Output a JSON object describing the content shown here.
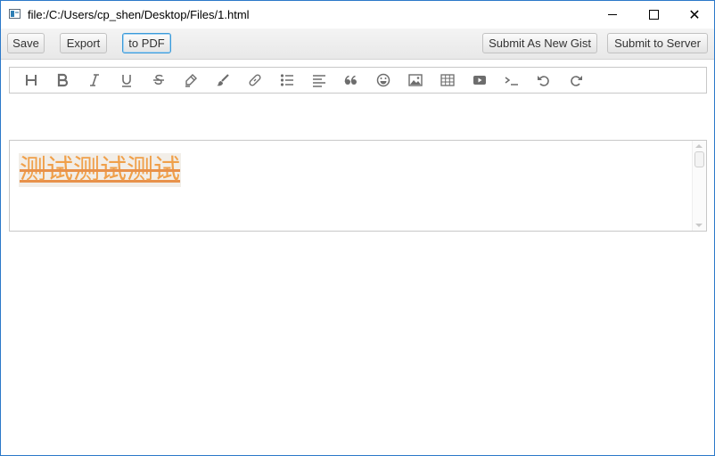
{
  "window": {
    "title": "file:/C:/Users/cp_shen/Desktop/Files/1.html",
    "controls": [
      "minimize-icon",
      "maximize-icon",
      "close-icon"
    ],
    "close_glyph": "✕"
  },
  "toolbar": {
    "save_label": "Save",
    "export_label": "Export",
    "pdf_label": "to PDF",
    "gist_label": "Submit As New Gist",
    "server_label": "Submit to Server"
  },
  "editor_toolbar": {
    "tools": [
      "heading-icon",
      "bold-icon",
      "italic-icon",
      "underline-icon",
      "strikethrough-icon",
      "highlighter-icon",
      "brush-icon",
      "link-icon",
      "bullet-list-icon",
      "align-left-icon",
      "quote-icon",
      "emoji-icon",
      "image-icon",
      "table-icon",
      "video-icon",
      "code-icon",
      "undo-icon",
      "redo-icon"
    ],
    "icon_color": "#6d6d6d"
  },
  "content": {
    "text": "测试测试测试",
    "text_color": "#f0a04a",
    "highlight_color": "#f2eee8"
  },
  "colors": {
    "focus_border": "#3a9ad9",
    "window_border": "#2b79c9"
  }
}
